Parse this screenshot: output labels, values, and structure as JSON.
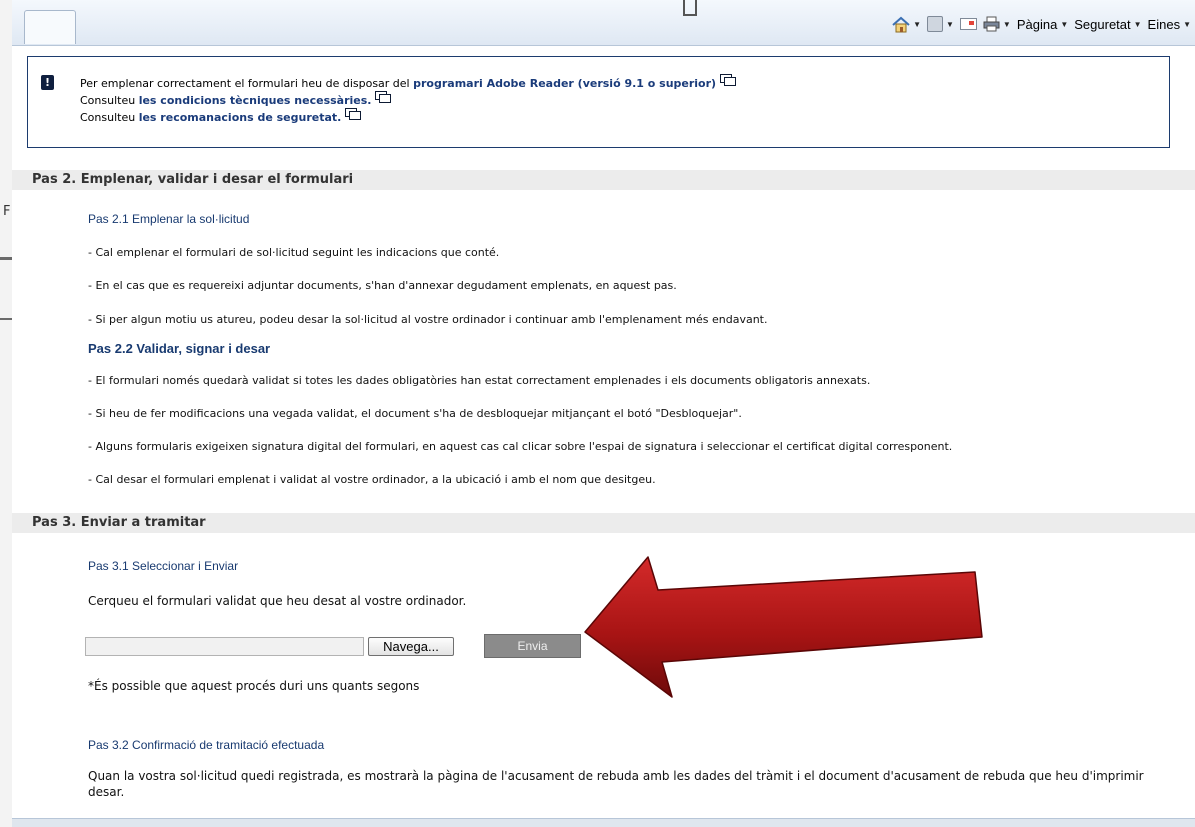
{
  "background_fragment": {
    "letter": "F"
  },
  "toolbar": {
    "page_label": "Pàgina",
    "security_label": "Seguretat",
    "tools_label": "Eines",
    "icons": [
      "home-icon",
      "feed-icon",
      "mail-icon",
      "print-icon"
    ]
  },
  "info": {
    "line1_prefix": "Per emplenar correctament el formulari heu de disposar del ",
    "line1_link": "programari Adobe Reader (versió 9.1 o superior)",
    "line2_prefix": "Consulteu ",
    "line2_link": "les condicions tècniques necessàries.",
    "line3_prefix": "Consulteu ",
    "line3_link": "les recomanacions de seguretat."
  },
  "step2": {
    "title": "Pas 2. Emplenar, validar i desar el formulari",
    "sub1": {
      "title": "Pas 2.1 Emplenar la sol·licitud",
      "items": [
        "- Cal emplenar el formulari de sol·licitud seguint les indicacions que conté.",
        "- En el cas que es requereixi adjuntar documents, s'han d'annexar degudament emplenats, en aquest pas.",
        "- Si per algun motiu us atureu, podeu desar la sol·licitud al vostre ordinador i continuar amb l'emplenament més endavant."
      ]
    },
    "sub2": {
      "title": "Pas 2.2 Validar, signar i desar",
      "items": [
        "- El formulari només quedarà validat si totes les dades obligatòries han estat correctament emplenades i els documents obligatoris annexats.",
        "- Si heu de fer modificacions una vegada validat, el document s'ha de desbloquejar mitjançant el botó \"Desbloquejar\".",
        "- Alguns formularis exigeixen signatura digital del formulari, en aquest cas cal clicar sobre l'espai de signatura i seleccionar el certificat digital corresponent.",
        "- Cal desar el formulari emplenat i validat al vostre ordinador, a la ubicació i amb el nom que desitgeu."
      ]
    }
  },
  "step3": {
    "title": "Pas 3. Enviar a tramitar",
    "sub1": {
      "title": "Pas 3.1 Seleccionar i Enviar",
      "instruction": "Cerqueu el formulari validat que heu desat al vostre ordinador.",
      "file_value": "",
      "browse_label": "Navega...",
      "send_label": "Envia",
      "note": "*És possible que aquest procés duri uns quants segons"
    },
    "sub2": {
      "title": "Pas 3.2 Confirmació de tramitació efectuada",
      "text_line1": "Quan la vostra sol·licitud quedi registrada, es mostrarà la pàgina de l'acusament de rebuda amb les dades del tràmit i el document d'acusament de rebuda que heu d'imprimir",
      "text_line2": "desar."
    }
  },
  "annotation": {
    "arrow_color": "#b01818"
  }
}
